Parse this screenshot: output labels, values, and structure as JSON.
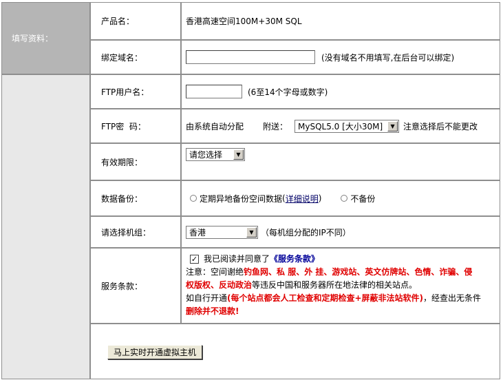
{
  "sidebar": {
    "section_label": "填写资料："
  },
  "rows": {
    "product": {
      "label": "产品名：",
      "value": "香港高速空间100M+30M SQL"
    },
    "domain": {
      "label": "绑定域名：",
      "input_value": "",
      "hint": "(没有域名不用填写,在后台可以绑定)"
    },
    "ftp_user": {
      "label": "FTP用户名：",
      "input_value": "",
      "hint": "(6至14个字母或数字)"
    },
    "ftp_pass": {
      "label": "FTP密  码：",
      "value": "由系统自动分配",
      "addon_label": "附送：",
      "addon_selected": "MySQL5.0 [大小30M]",
      "addon_note": "注意选择后不能更改"
    },
    "period": {
      "label": "有效期限：",
      "selected": "请您选择"
    },
    "backup": {
      "label": "数据备份：",
      "option1": "定期异地备份空间数据",
      "option1_link": "详细说明",
      "option1_paren_open": "(",
      "option1_paren_close": ")",
      "option2": "不备份"
    },
    "server": {
      "label": "请选择机组：",
      "selected": "香港",
      "hint": "（每机组分配的IP不同）"
    },
    "terms": {
      "label": "服务条款：",
      "agree_text": "我已阅读并同意了",
      "agree_link": "《服务条款》",
      "line2_prefix": "注意：空间谢绝",
      "line2_red": "钓鱼网、私 服、外 挂、游戏站、英文仿牌站、色情、诈骗、侵",
      "line3_red": "权版权、反动政治",
      "line3_rest": "等违反中国和服务器所在地法律的相关站点。",
      "line4_prefix": "如自行开通",
      "line4_red": "(每个站点都会人工检查和定期检查+屏蔽非法站软件)",
      "line4_rest": "，经查出无条件",
      "line5_red": "删除并不退款!"
    }
  },
  "submit": {
    "label": "马上实时开通虚拟主机"
  },
  "colors": {
    "sidebar_top": "#b5b5b5",
    "sidebar_bottom": "#e8e8e8",
    "border": "#8e8e8e",
    "warning_red": "#e00000",
    "link_blue": "#000099"
  }
}
